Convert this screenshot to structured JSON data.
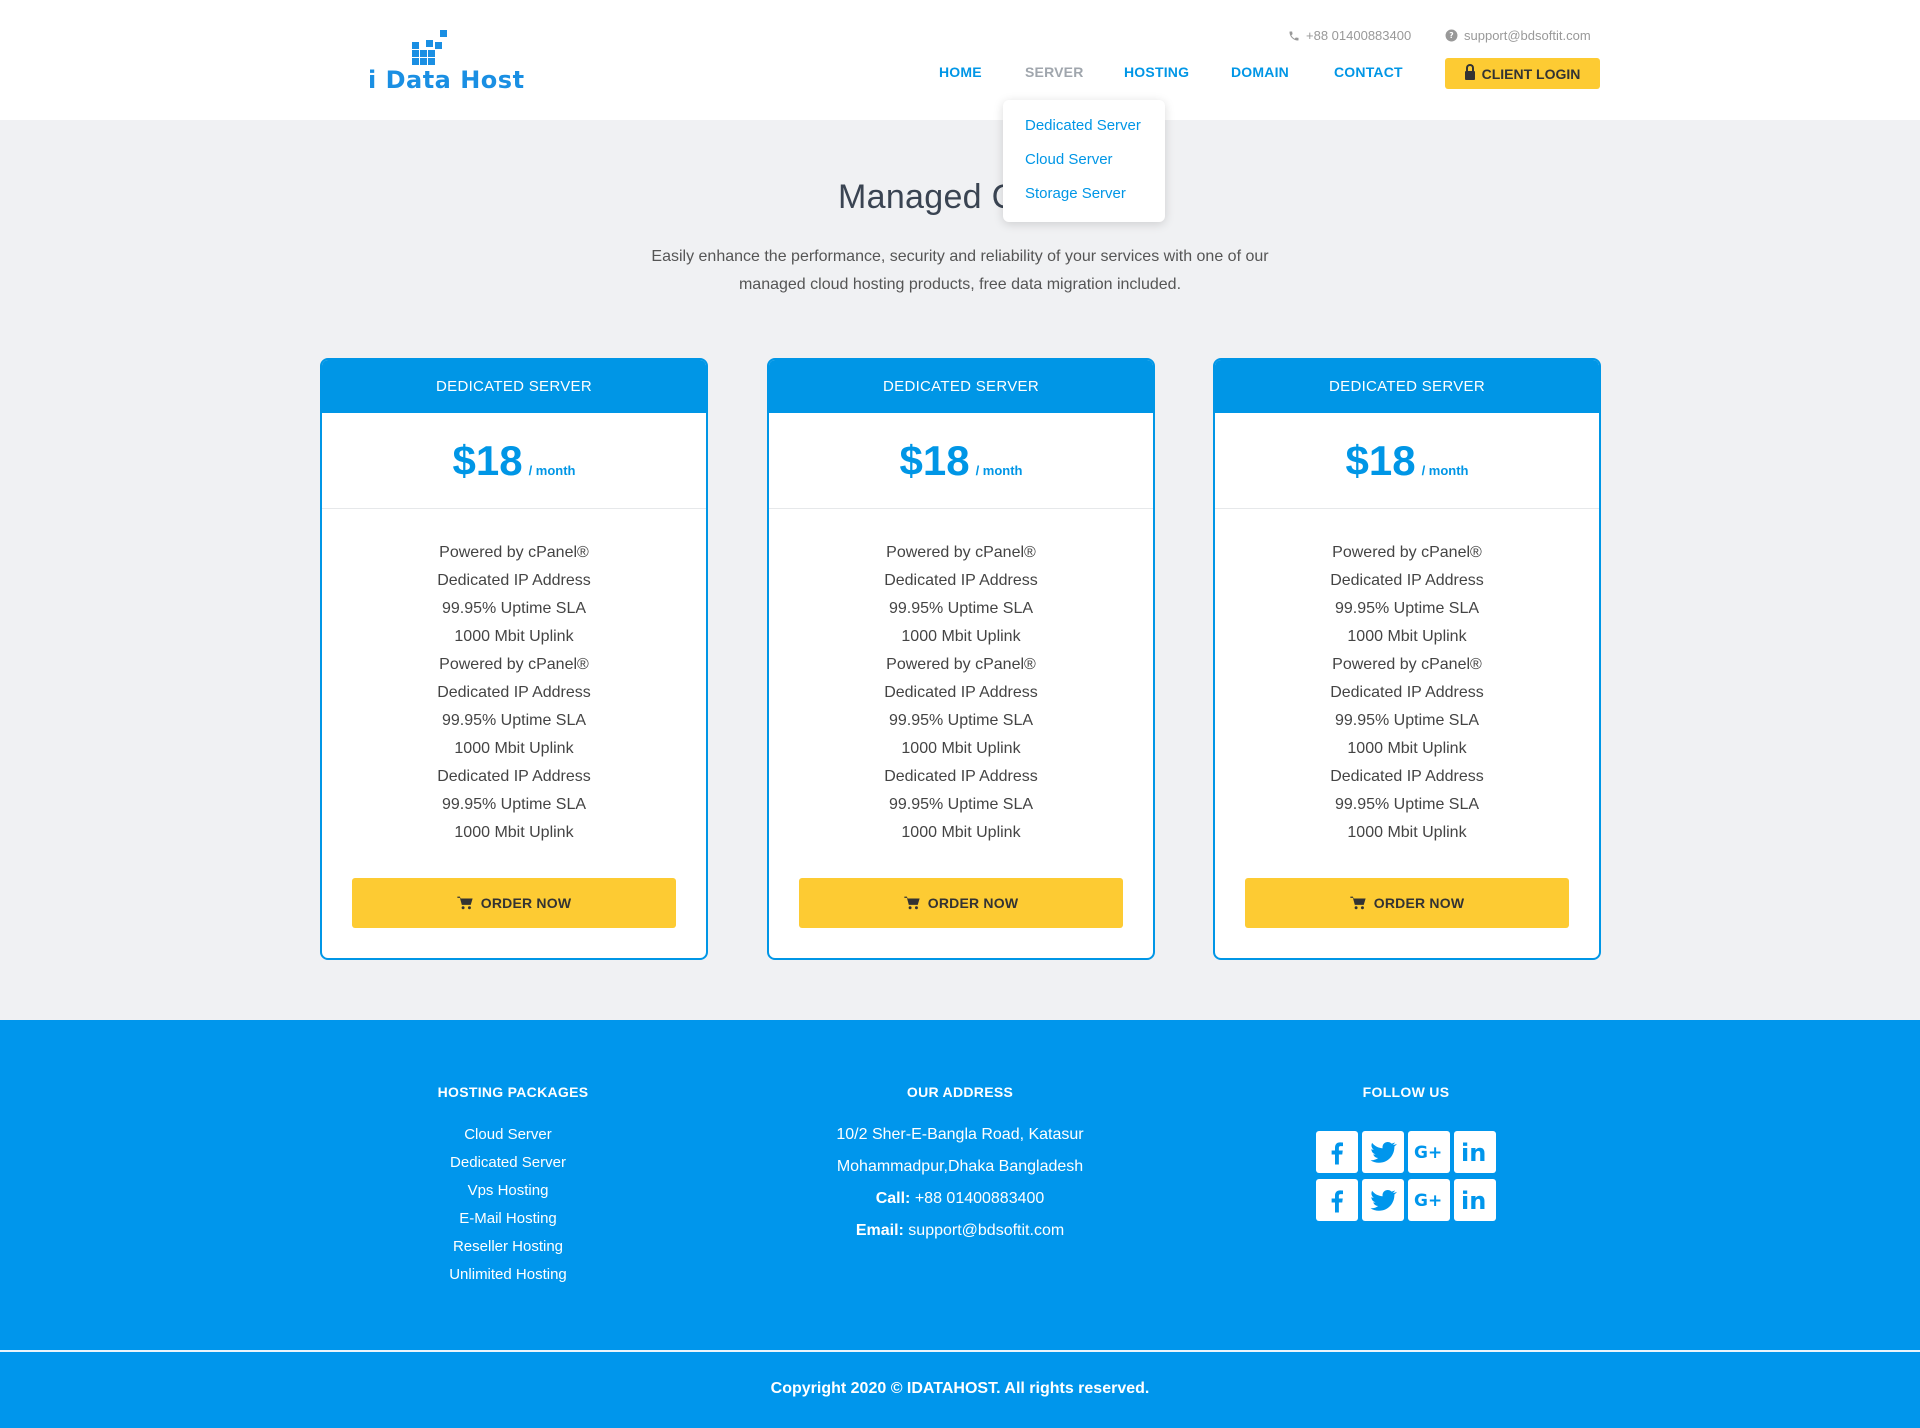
{
  "header": {
    "logo_text": "i Data Host",
    "phone": "+88 01400883400",
    "email": "support@bdsoftit.com",
    "nav": [
      {
        "label": "HOME"
      },
      {
        "label": "SERVER"
      },
      {
        "label": "HOSTING"
      },
      {
        "label": "DOMAIN"
      },
      {
        "label": "CONTACT"
      }
    ],
    "login_label": "CLIENT LOGIN",
    "dropdown": [
      "Dedicated Server",
      "Cloud Server",
      "Storage Server"
    ]
  },
  "main": {
    "title": "Managed Cloud",
    "intro_line1": "Easily enhance the performance, security and reliability of your services with one of our",
    "intro_line2": "managed cloud hosting products, free data migration included."
  },
  "plans": [
    {
      "name": "DEDICATED SERVER",
      "price": "$18",
      "period": "/ month",
      "features": [
        "Powered by cPanel®",
        "Dedicated IP Address",
        "99.95% Uptime SLA",
        "1000 Mbit Uplink",
        "Powered by cPanel®",
        "Dedicated IP Address",
        "99.95% Uptime SLA",
        "1000 Mbit Uplink",
        "Dedicated IP Address",
        "99.95% Uptime SLA",
        "1000 Mbit Uplink"
      ],
      "button": "ORDER NOW"
    },
    {
      "name": "DEDICATED SERVER",
      "price": "$18",
      "period": "/ month",
      "features": [
        "Powered by cPanel®",
        "Dedicated IP Address",
        "99.95% Uptime SLA",
        "1000 Mbit Uplink",
        "Powered by cPanel®",
        "Dedicated IP Address",
        "99.95% Uptime SLA",
        "1000 Mbit Uplink",
        "Dedicated IP Address",
        "99.95% Uptime SLA",
        "1000 Mbit Uplink"
      ],
      "button": "ORDER NOW"
    },
    {
      "name": "DEDICATED SERVER",
      "price": "$18",
      "period": "/ month",
      "features": [
        "Powered by cPanel®",
        "Dedicated IP Address",
        "99.95% Uptime SLA",
        "1000 Mbit Uplink",
        "Powered by cPanel®",
        "Dedicated IP Address",
        "99.95% Uptime SLA",
        "1000 Mbit Uplink",
        "Dedicated IP Address",
        "99.95% Uptime SLA",
        "1000 Mbit Uplink"
      ],
      "button": "ORDER NOW"
    }
  ],
  "footer": {
    "packages_heading": "HOSTING PACKAGES",
    "packages": [
      "Cloud Server",
      "Dedicated Server",
      "Vps Hosting",
      "E-Mail Hosting",
      "Reseller Hosting",
      "Unlimited Hosting"
    ],
    "address_heading": "OUR ADDRESS",
    "address_line1": "10/2 Sher-E-Bangla Road, Katasur",
    "address_line2": "Mohammadpur,Dhaka Bangladesh",
    "call_label": "Call:",
    "call_value": "+88 01400883400",
    "email_label": "Email:",
    "email_value": "support@bdsoftit.com",
    "follow_heading": "FOLLOW US",
    "social_icons": [
      "facebook-icon",
      "twitter-icon",
      "google-plus-icon",
      "linkedin-icon"
    ],
    "copyright": "Copyright 2020 © IDATAHOST. All rights reserved."
  },
  "colors": {
    "brand_blue": "#0096e6",
    "accent_yellow": "#fdcb33",
    "footer_blue": "#0096ec"
  }
}
